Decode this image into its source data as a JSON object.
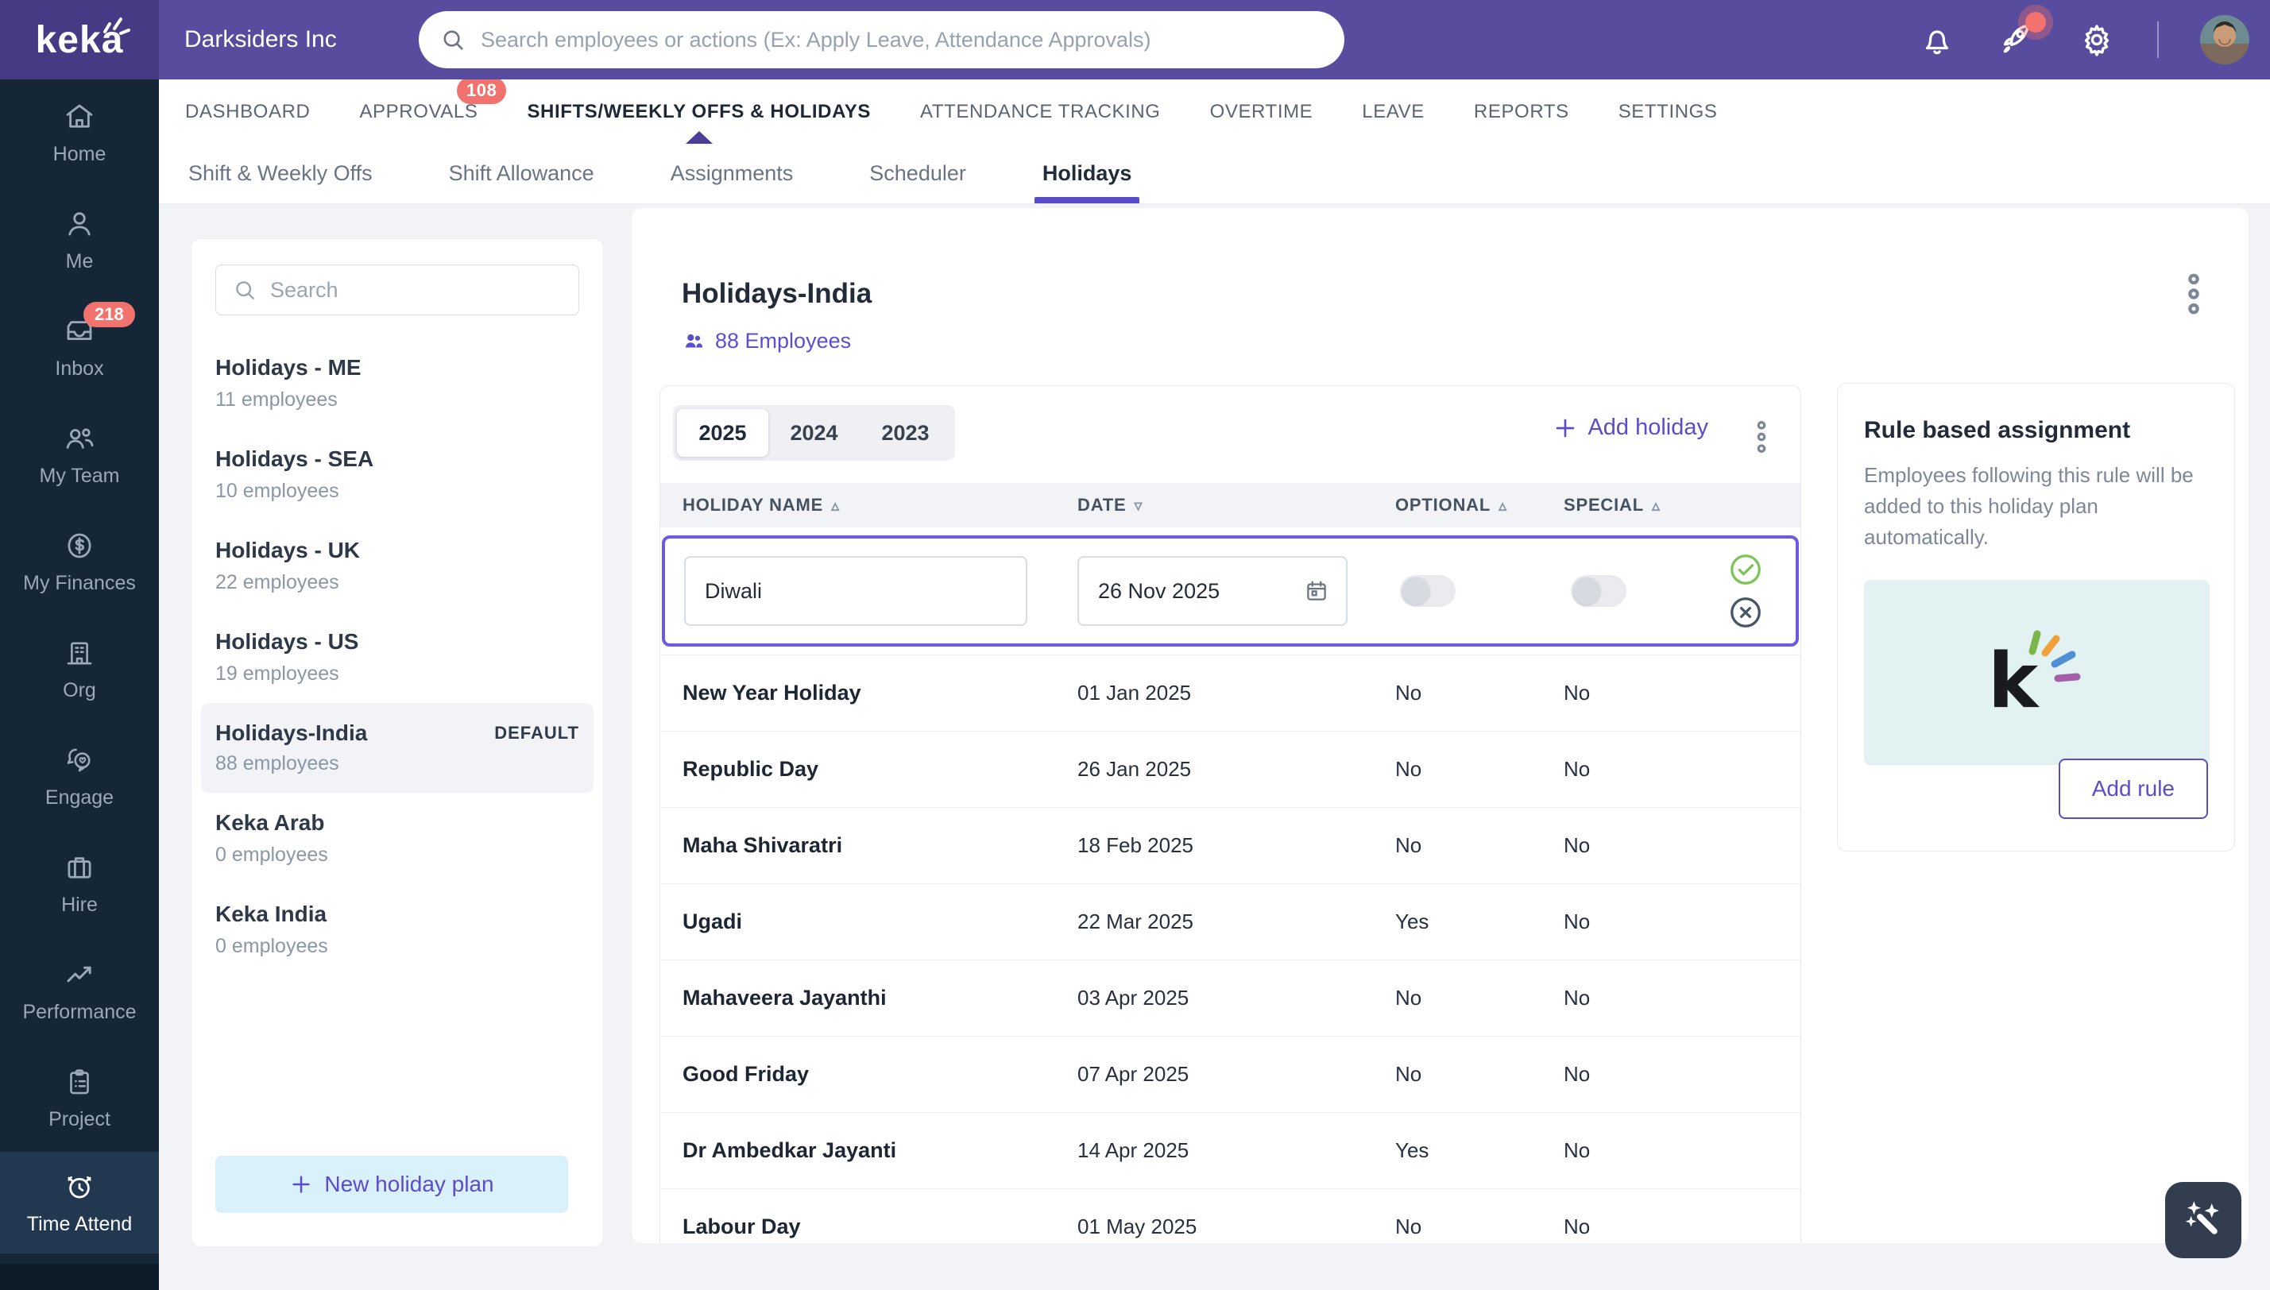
{
  "topbar": {
    "logo": "keka",
    "company": "Darksiders Inc",
    "search_placeholder": "Search employees or actions (Ex: Apply Leave, Attendance Approvals)"
  },
  "sidebar": {
    "items": [
      {
        "icon": "home",
        "label": "Home",
        "badge": "",
        "active": false
      },
      {
        "icon": "user",
        "label": "Me",
        "badge": "",
        "active": false
      },
      {
        "icon": "inbox",
        "label": "Inbox",
        "badge": "218",
        "active": false
      },
      {
        "icon": "team",
        "label": "My Team",
        "badge": "",
        "active": false
      },
      {
        "icon": "finance",
        "label": "My Finances",
        "badge": "",
        "active": false
      },
      {
        "icon": "org",
        "label": "Org",
        "badge": "",
        "active": false
      },
      {
        "icon": "engage",
        "label": "Engage",
        "badge": "",
        "active": false
      },
      {
        "icon": "hire",
        "label": "Hire",
        "badge": "",
        "active": false
      },
      {
        "icon": "performance",
        "label": "Performance",
        "badge": "",
        "active": false
      },
      {
        "icon": "project",
        "label": "Project",
        "badge": "",
        "active": false
      },
      {
        "icon": "time",
        "label": "Time Attend",
        "badge": "",
        "active": true
      }
    ]
  },
  "nav": {
    "items": [
      {
        "label": "DASHBOARD",
        "badge": "",
        "active": false
      },
      {
        "label": "APPROVALS",
        "badge": "108",
        "active": false
      },
      {
        "label": "SHIFTS/WEEKLY OFFS & HOLIDAYS",
        "badge": "",
        "active": true
      },
      {
        "label": "ATTENDANCE TRACKING",
        "badge": "",
        "active": false
      },
      {
        "label": "OVERTIME",
        "badge": "",
        "active": false
      },
      {
        "label": "LEAVE",
        "badge": "",
        "active": false
      },
      {
        "label": "REPORTS",
        "badge": "",
        "active": false
      },
      {
        "label": "SETTINGS",
        "badge": "",
        "active": false
      }
    ]
  },
  "subtabs": {
    "items": [
      {
        "label": "Shift & Weekly Offs",
        "active": false
      },
      {
        "label": "Shift Allowance",
        "active": false
      },
      {
        "label": "Assignments",
        "active": false
      },
      {
        "label": "Scheduler",
        "active": false
      },
      {
        "label": "Holidays",
        "active": true
      }
    ]
  },
  "plans": {
    "search_placeholder": "Search",
    "items": [
      {
        "name": "Holidays - ME",
        "employees": "11 employees",
        "badge": "",
        "selected": false
      },
      {
        "name": "Holidays - SEA",
        "employees": "10 employees",
        "badge": "",
        "selected": false
      },
      {
        "name": "Holidays - UK",
        "employees": "22 employees",
        "badge": "",
        "selected": false
      },
      {
        "name": "Holidays - US",
        "employees": "19 employees",
        "badge": "",
        "selected": false
      },
      {
        "name": "Holidays-India",
        "employees": "88 employees",
        "badge": "DEFAULT",
        "selected": true
      },
      {
        "name": "Keka Arab",
        "employees": "0 employees",
        "badge": "",
        "selected": false
      },
      {
        "name": "Keka India",
        "employees": "0 employees",
        "badge": "",
        "selected": false
      }
    ],
    "new_plan_label": "New holiday plan"
  },
  "main": {
    "title": "Holidays-India",
    "employees_link": "88 Employees",
    "years": [
      {
        "label": "2025",
        "active": true
      },
      {
        "label": "2024",
        "active": false
      },
      {
        "label": "2023",
        "active": false
      }
    ],
    "add_holiday_label": "Add holiday",
    "table": {
      "columns": [
        {
          "label": "HOLIDAY NAME",
          "sort_icon": "▵"
        },
        {
          "label": "DATE",
          "sort_icon": "▿"
        },
        {
          "label": "OPTIONAL",
          "sort_icon": "▵"
        },
        {
          "label": "SPECIAL",
          "sort_icon": "▵"
        }
      ],
      "edit_row": {
        "name": "Diwali",
        "date": "26 Nov 2025"
      },
      "rows": [
        {
          "name": "New Year Holiday",
          "date": "01 Jan 2025",
          "optional": "No",
          "special": "No"
        },
        {
          "name": "Republic Day",
          "date": "26 Jan 2025",
          "optional": "No",
          "special": "No"
        },
        {
          "name": "Maha Shivaratri",
          "date": "18 Feb 2025",
          "optional": "No",
          "special": "No"
        },
        {
          "name": "Ugadi",
          "date": "22 Mar 2025",
          "optional": "Yes",
          "special": "No"
        },
        {
          "name": "Mahaveera Jayanthi",
          "date": "03 Apr 2025",
          "optional": "No",
          "special": "No"
        },
        {
          "name": "Good Friday",
          "date": "07 Apr 2025",
          "optional": "No",
          "special": "No"
        },
        {
          "name": "Dr Ambedkar Jayanti",
          "date": "14 Apr 2025",
          "optional": "Yes",
          "special": "No"
        },
        {
          "name": "Labour Day",
          "date": "01 May 2025",
          "optional": "No",
          "special": "No"
        }
      ]
    }
  },
  "rule_panel": {
    "title": "Rule based assignment",
    "description": "Employees following this rule will be added to this holiday plan automatically.",
    "button": "Add rule"
  },
  "colors": {
    "topbar": "#584c9e",
    "logo_box": "#453a84",
    "sidebar": "#152636",
    "accent_purple": "#5b4ccc",
    "badge_red": "#f2726d",
    "page_bg": "#f1f3f6",
    "mint_box": "#e2f1f2",
    "new_plan_bg": "#d9f1fa",
    "success_green": "#7ac555"
  }
}
